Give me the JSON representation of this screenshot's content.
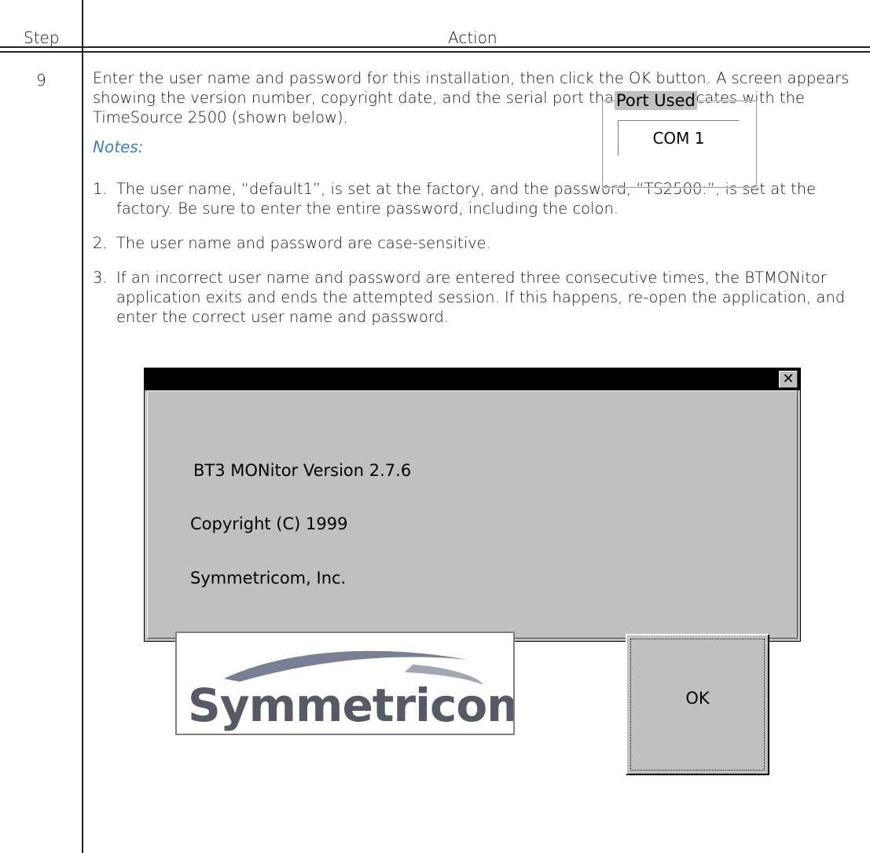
{
  "table": {
    "header_step": "Step",
    "header_action": "Action",
    "step_number": "9"
  },
  "content": {
    "intro": "Enter the user name and password for this installation, then click the OK button. A screen appears showing the version number, copyright date, and the serial port that communicates with the TimeSource 2500 (shown below).",
    "notes_label": "Notes:",
    "notes": [
      {
        "num": "1.",
        "text": "The user name, “default1”, is set at the factory, and the password, “TS2500:”, is set at the factory. Be sure to enter the entire password, including the colon."
      },
      {
        "num": "2.",
        "text": "The user name and password are case-sensitive."
      },
      {
        "num": "3.",
        "text": "If an incorrect user name and password are entered three consecutive times, the BTMONitor application exits and ends the attempted session. If this happens, re-open the application, and enter the correct user name and password."
      }
    ]
  },
  "dialog": {
    "close_glyph": "✕",
    "version_text": "BT3 MONitor Version   2.7.6",
    "copyright_text": "Copyright (C) 1999",
    "company_text": "Symmetricom, Inc.",
    "port_group_label": "Port Used",
    "port_value": "COM 1",
    "logo_text": "Symmetricom",
    "ok_label": "OK"
  },
  "colors": {
    "notes_accent": "#3b7fc4",
    "dialog_face": "#c0c0c0",
    "title_bar": "#000000",
    "logo_text": "#555a66",
    "logo_swoosh": "#7a8094"
  }
}
